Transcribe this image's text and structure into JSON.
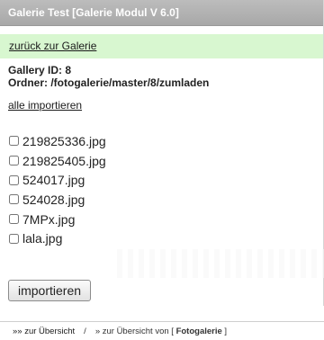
{
  "header": {
    "title": "Galerie Test [Galerie Modul V 6.0]"
  },
  "back_link": "zurück zur Galerie",
  "info": {
    "gallery_id": "Gallery ID: 8",
    "folder": "Ordner: /fotogalerie/master/8/zumladen"
  },
  "import_all_link": "alle importieren",
  "files": [
    {
      "name": "219825336.jpg",
      "checked": false
    },
    {
      "name": "219825405.jpg",
      "checked": false
    },
    {
      "name": "524017.jpg",
      "checked": false
    },
    {
      "name": "524028.jpg",
      "checked": false
    },
    {
      "name": "7MPx.jpg",
      "checked": false
    },
    {
      "name": "lala.jpg",
      "checked": false
    }
  ],
  "import_button_label": "importieren",
  "footer": {
    "overview_link": "»» zur Übersicht",
    "separator": "/",
    "overview_of_prefix": "» zur Übersicht von [",
    "overview_of_name": "Fotogalerie",
    "overview_of_suffix": "]"
  },
  "colors": {
    "titlebar": "#b4b4b4",
    "backbar": "#d8f7d0"
  }
}
